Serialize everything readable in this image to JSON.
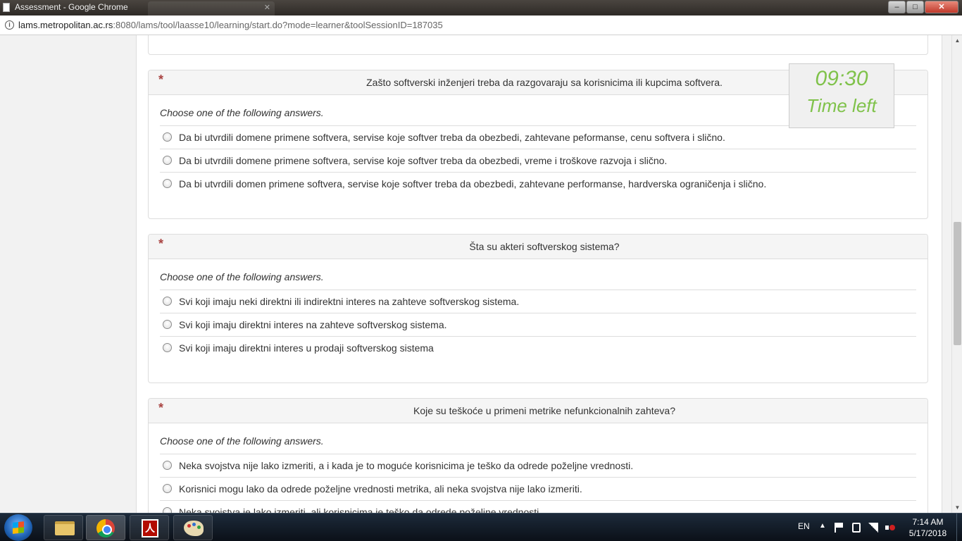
{
  "window": {
    "title": "Assessment - Google Chrome",
    "min_label": "–",
    "max_label": "□",
    "close_label": "✕"
  },
  "address": {
    "host": "lams.metropolitan.ac.rs",
    "path": ":8080/lams/tool/laasse10/learning/start.do?mode=learner&toolSessionID=187035"
  },
  "timer": {
    "time": "09:30",
    "label": "Time left",
    "color": "#7fc24a"
  },
  "questions": [
    {
      "required_mark": "*",
      "text": "Zašto softverski inženjeri treba da razgovaraju sa korisnicima ili kupcima softvera.",
      "hint": "Choose one of the following answers.",
      "options": [
        "Da bi utvrdili domene primene softvera, servise koje softver treba da obezbedi, zahtevane peformanse, cenu softvera i slično.",
        "Da bi utvrdili domene primene softvera, servise koje softver treba da obezbedi, vreme i troškove razvoja i slično.",
        "Da bi utvrdili domen primene softvera, servise koje softver treba da obezbedi, zahtevane performanse, hardverska ograničenja i slično."
      ]
    },
    {
      "required_mark": "*",
      "text": "Šta su akteri softverskog sistema?",
      "hint": "Choose one of the following answers.",
      "options": [
        "Svi koji imaju neki direktni ili indirektni interes na zahteve softverskog sistema.",
        "Svi koji imaju direktni interes na zahteve softverskog sistema.",
        "Svi koji imaju direktni interes u prodaji softverskog sistema"
      ]
    },
    {
      "required_mark": "*",
      "text": "Koje su teškoće u primeni metrike nefunkcionalnih zahteva?",
      "hint": "Choose one of the following answers.",
      "options": [
        "Neka svojstva nije lako izmeriti, a i kada je to moguće korisnicima je teško da odrede poželjne vrednosti.",
        "Korisnici mogu lako da odrede poželjne vrednosti metrika, ali neka svojstva nije lako izmeriti.",
        "Neka svojstva je lako izmeriti, ali korisnicima je teško da odrede poželjne vrednosti."
      ]
    }
  ],
  "taskbar": {
    "acrobat_glyph": "人",
    "language": "EN",
    "tray_up": "▲",
    "time": "7:14 AM",
    "date": "5/17/2018"
  },
  "icons": {
    "info": "info-icon",
    "radio": "radio-button"
  }
}
